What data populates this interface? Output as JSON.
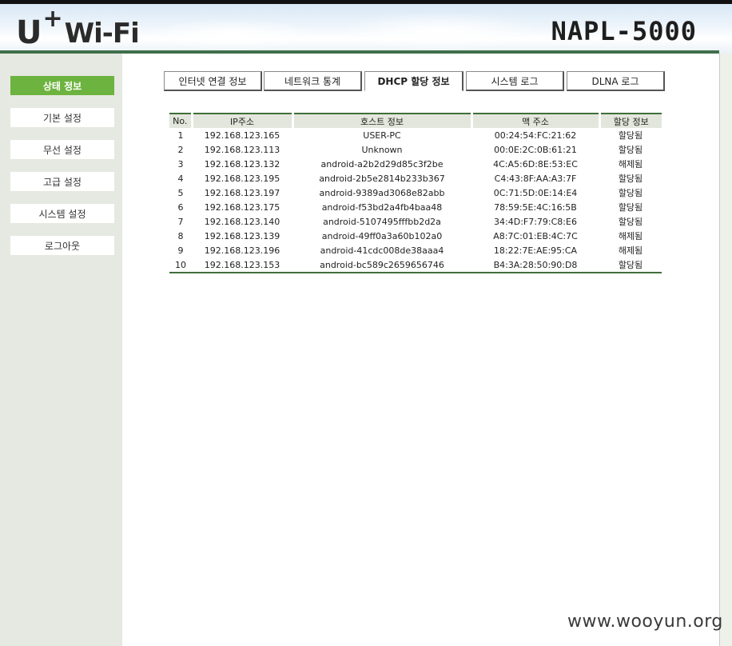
{
  "header": {
    "logo_u": "U",
    "logo_plus": "+",
    "logo_wifi": "Wi-Fi",
    "model": "NAPL-5000"
  },
  "sidebar": {
    "items": [
      {
        "label": "상태 정보",
        "active": true
      },
      {
        "label": "기본 설정"
      },
      {
        "label": "무선 설정"
      },
      {
        "label": "고급 설정"
      },
      {
        "label": "시스템 설정"
      },
      {
        "label": "로그아웃"
      }
    ]
  },
  "tabs": [
    {
      "label": "인터넷 연결 정보"
    },
    {
      "label": "네트워크 통계"
    },
    {
      "label": "DHCP 할당 정보",
      "active": true
    },
    {
      "label": "시스템 로그"
    },
    {
      "label": "DLNA 로그"
    }
  ],
  "table": {
    "headers": [
      "No.",
      "IP주소",
      "호스트 정보",
      "맥 주소",
      "할당 정보"
    ],
    "rows": [
      [
        "1",
        "192.168.123.165",
        "USER-PC",
        "00:24:54:FC:21:62",
        "할당됨"
      ],
      [
        "2",
        "192.168.123.113",
        "Unknown",
        "00:0E:2C:0B:61:21",
        "할당됨"
      ],
      [
        "3",
        "192.168.123.132",
        "android-a2b2d29d85c3f2be",
        "4C:A5:6D:8E:53:EC",
        "해제됨"
      ],
      [
        "4",
        "192.168.123.195",
        "android-2b5e2814b233b367",
        "C4:43:8F:AA:A3:7F",
        "할당됨"
      ],
      [
        "5",
        "192.168.123.197",
        "android-9389ad3068e82abb",
        "0C:71:5D:0E:14:E4",
        "할당됨"
      ],
      [
        "6",
        "192.168.123.175",
        "android-f53bd2a4fb4baa48",
        "78:59:5E:4C:16:5B",
        "할당됨"
      ],
      [
        "7",
        "192.168.123.140",
        "android-5107495fffbb2d2a",
        "34:4D:F7:79:C8:E6",
        "할당됨"
      ],
      [
        "8",
        "192.168.123.139",
        "android-49ff0a3a60b102a0",
        "A8:7C:01:EB:4C:7C",
        "해제됨"
      ],
      [
        "9",
        "192.168.123.196",
        "android-41cdc008de38aaa4",
        "18:22:7E:AE:95:CA",
        "해제됨"
      ],
      [
        "10",
        "192.168.123.153",
        "android-bc589c2659656746",
        "B4:3A:28:50:90:D8",
        "할당됨"
      ]
    ]
  },
  "watermark": "www.wooyun.org",
  "colors": {
    "accent_green": "#6db33f",
    "line_green": "#3f6f3a",
    "sidebar_bg": "#e6e9e1"
  }
}
